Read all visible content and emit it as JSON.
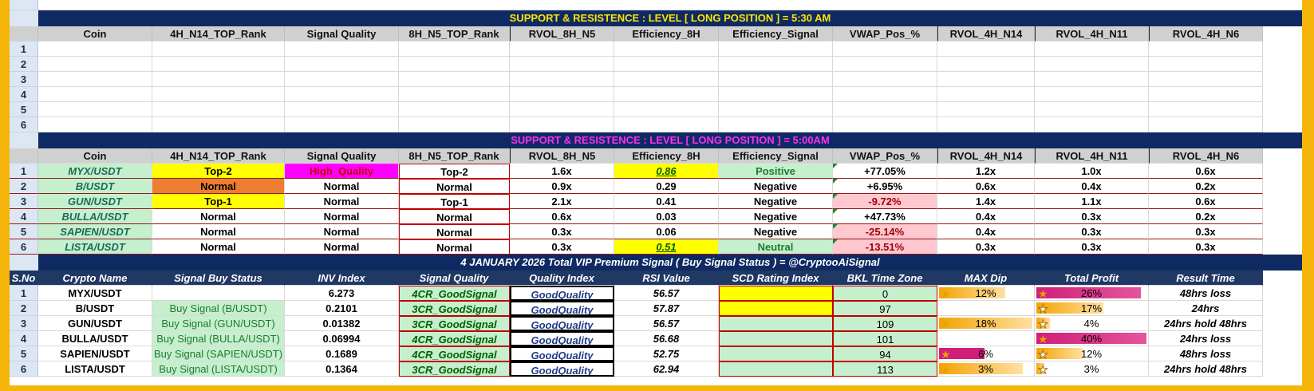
{
  "banner1": "SUPPORT  &  RESISTENCE :  LEVEL    [   LONG   POSITION  ]       =       5:30 AM",
  "banner2": "SUPPORT  &  RESISTENCE :  LEVEL    [   LONG   POSITION  ]       =       5:00AM",
  "banner3": "4   JANUARY   2026   Total VIP Premium Signal  ( Buy Signal Status )    =   @CryptooAiSignal",
  "headers": [
    "Coin",
    "4H_N14_TOP_Rank",
    "Signal Quality",
    "8H_N5_TOP_Rank",
    "RVOL_8H_N5",
    "Efficiency_8H",
    "Efficiency_Signal",
    "VWAP_Pos_%",
    "RVOL_4H_N14",
    "RVOL_4H_N11",
    "RVOL_4H_N6"
  ],
  "row_numbers": [
    "1",
    "2",
    "3",
    "4",
    "5",
    "6"
  ],
  "table2": [
    {
      "coin": "MYX/USDT",
      "rank4h": "Top-2",
      "quality": "High_Quality",
      "rank8h": "Top-2",
      "rvol8h": "1.6x",
      "eff": "0.86",
      "effsig": "Positive",
      "vwap": "+77.05%",
      "r14": "1.2x",
      "r11": "1.0x",
      "r6": "0.6x"
    },
    {
      "coin": "B/USDT",
      "rank4h": "Normal",
      "quality": "Normal",
      "rank8h": "Normal",
      "rvol8h": "0.9x",
      "eff": "0.29",
      "effsig": "Negative",
      "vwap": "+6.95%",
      "r14": "0.6x",
      "r11": "0.4x",
      "r6": "0.2x"
    },
    {
      "coin": "GUN/USDT",
      "rank4h": "Top-1",
      "quality": "Normal",
      "rank8h": "Top-1",
      "rvol8h": "2.1x",
      "eff": "0.41",
      "effsig": "Negative",
      "vwap": "-9.72%",
      "r14": "1.4x",
      "r11": "1.1x",
      "r6": "0.6x"
    },
    {
      "coin": "BULLA/USDT",
      "rank4h": "Normal",
      "quality": "Normal",
      "rank8h": "Normal",
      "rvol8h": "0.6x",
      "eff": "0.03",
      "effsig": "Negative",
      "vwap": "+47.73%",
      "r14": "0.4x",
      "r11": "0.3x",
      "r6": "0.2x"
    },
    {
      "coin": "SAPIEN/USDT",
      "rank4h": "Normal",
      "quality": "Normal",
      "rank8h": "Normal",
      "rvol8h": "0.3x",
      "eff": "0.06",
      "effsig": "Negative",
      "vwap": "-25.14%",
      "r14": "0.4x",
      "r11": "0.3x",
      "r6": "0.3x"
    },
    {
      "coin": "LISTA/USDT",
      "rank4h": "Normal",
      "quality": "Normal",
      "rank8h": "Normal",
      "rvol8h": "0.3x",
      "eff": "0.51",
      "effsig": "Neutral",
      "vwap": "-13.51%",
      "r14": "0.3x",
      "r11": "0.3x",
      "r6": "0.3x"
    }
  ],
  "headers3": [
    "S.No",
    "Crypto Name",
    "Signal Buy Status",
    "INV  Index",
    "Signal Quality",
    "Quality Index",
    "RSI Value",
    "SCD  Rating Index",
    "BKL Time Zone",
    "MAX Dip",
    "Total Profit",
    "Result Time"
  ],
  "table3": [
    {
      "no": "1",
      "name": "MYX/USDT",
      "status": "",
      "inv": "6.273",
      "sq": "4CR_GoodSignal",
      "qi": "GoodQuality",
      "rsi": "56.57",
      "bkl": "0",
      "dip": "12%",
      "dip_frac": 0.72,
      "profit": "26%",
      "profit_frac": 0.95,
      "result": "48hrs loss"
    },
    {
      "no": "2",
      "name": "B/USDT",
      "status": "Buy Signal (B/USDT)",
      "inv": "0.2101",
      "sq": "3CR_GoodSignal",
      "qi": "GoodQuality",
      "rsi": "57.87",
      "bkl": "97",
      "dip": "",
      "dip_frac": 0,
      "profit": "17%",
      "profit_frac": 0.62,
      "result": "24hrs"
    },
    {
      "no": "3",
      "name": "GUN/USDT",
      "status": "Buy Signal (GUN/USDT)",
      "inv": "0.01382",
      "sq": "3CR_GoodSignal",
      "qi": "GoodQuality",
      "rsi": "56.57",
      "bkl": "109",
      "dip": "18%",
      "dip_frac": 1.0,
      "profit": "4%",
      "profit_frac": 0.15,
      "result": "24hrs hold  48hrs"
    },
    {
      "no": "4",
      "name": "BULLA/USDT",
      "status": "Buy Signal (BULLA/USDT)",
      "inv": "0.06994",
      "sq": "4CR_GoodSignal",
      "qi": "GoodQuality",
      "rsi": "56.68",
      "bkl": "101",
      "dip": "",
      "dip_frac": 0,
      "profit": "40%",
      "profit_frac": 1.0,
      "result": "24hrs loss"
    },
    {
      "no": "5",
      "name": "SAPIEN/USDT",
      "status": "Buy Signal (SAPIEN/USDT)",
      "inv": "0.1689",
      "sq": "4CR_GoodSignal",
      "qi": "GoodQuality",
      "rsi": "52.75",
      "bkl": "94",
      "dip": "6%",
      "dip_frac": 0.5,
      "profit": "12%",
      "profit_frac": 0.44,
      "result": "48hrs loss"
    },
    {
      "no": "6",
      "name": "LISTA/USDT",
      "status": "Buy Signal (LISTA/USDT)",
      "inv": "0.1364",
      "sq": "3CR_GoodSignal",
      "qi": "GoodQuality",
      "rsi": "62.94",
      "bkl": "113",
      "dip": "3%",
      "dip_frac": 0.9,
      "profit": "3%",
      "profit_frac": 0.1,
      "result": "24hrs hold  48hrs"
    }
  ],
  "colors": {
    "banner_bg": "#0f2a63",
    "yellow": "#ffff00",
    "magenta": "#ff00ff",
    "orange": "#ed7d31",
    "mint": "#c6efce",
    "pink": "#ffc7ce",
    "frame": "#f5b50a"
  }
}
